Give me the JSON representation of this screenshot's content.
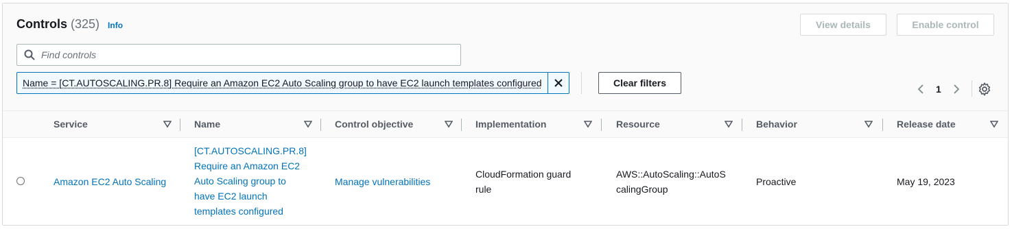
{
  "header": {
    "title": "Controls",
    "count": "(325)",
    "info_label": "Info",
    "view_details_label": "View details",
    "enable_control_label": "Enable control"
  },
  "search": {
    "placeholder": "Find controls"
  },
  "filter": {
    "token_label": "Name = [CT.AUTOSCALING.PR.8] Require an Amazon EC2 Auto Scaling group to have EC2 launch templates configured",
    "clear_label": "Clear filters"
  },
  "pagination": {
    "current_page": "1"
  },
  "table": {
    "columns": [
      "Service",
      "Name",
      "Control objective",
      "Implementation",
      "Resource",
      "Behavior",
      "Release date"
    ],
    "rows": [
      {
        "service": "Amazon EC2 Auto Scaling",
        "name": "[CT.AUTOSCALING.PR.8] Require an Amazon EC2 Auto Scaling group to have EC2 launch templates configured",
        "control_objective": "Manage vulnerabilities",
        "implementation": "CloudFormation guard rule",
        "resource": "AWS::AutoScaling::AutoScalingGroup",
        "behavior": "Proactive",
        "release_date": "May 19, 2023"
      }
    ]
  },
  "colors": {
    "link": "#0073bb",
    "text": "#16191f",
    "muted": "#687078",
    "disabled": "#aab7b8"
  }
}
